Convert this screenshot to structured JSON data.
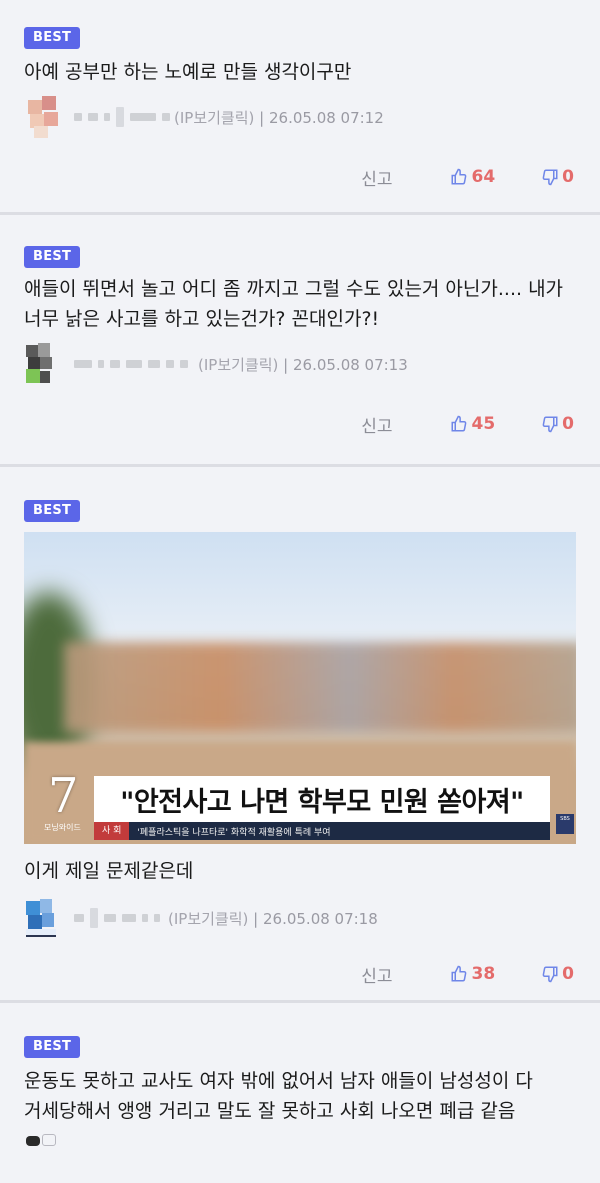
{
  "comments": [
    {
      "badge": "BEST",
      "text": "아예 공부만 하는 노예로 만들 생각이구만",
      "ip_label": "(IP보기클릭)",
      "timestamp": "| 26.05.08 07:12",
      "report": "신고",
      "likes": "64",
      "dislikes": "0"
    },
    {
      "badge": "BEST",
      "text": "애들이 뛰면서 놀고 어디 좀 까지고 그럴 수도 있는거 아닌가.... 내가 너무 낡은 사고를 하고 있는건가? 꼰대인가?!",
      "ip_label": "(IP보기클릭)",
      "timestamp": "| 26.05.08 07:13",
      "report": "신고",
      "likes": "45",
      "dislikes": "0"
    },
    {
      "badge": "BEST",
      "image": {
        "number": "7",
        "number_sub": "모닝와이드",
        "headline": "\"안전사고 나면 학부모 민원 쏟아져\"",
        "ticker_tag": "사 회",
        "ticker_text": "'폐플라스틱을 나프타로' 화학적 재활용에 특례 부여",
        "logo": "SBS"
      },
      "text": "이게 제일 문제같은데",
      "ip_label": "(IP보기클릭)",
      "timestamp": "| 26.05.08 07:18",
      "report": "신고",
      "likes": "38",
      "dislikes": "0"
    },
    {
      "badge": "BEST",
      "text": "운동도 못하고 교사도 여자 밖에 없어서 남자 애들이 남성성이 다 거세당해서 앵앵 거리고 말도 잘 못하고 사회 나오면 폐급 같음"
    }
  ],
  "colors": {
    "badge": "#5b66e8",
    "like": "#e46b6b",
    "background": "#f2f3f7"
  },
  "icons": [
    "thumbs-up-icon",
    "thumbs-down-icon",
    "avatar"
  ]
}
